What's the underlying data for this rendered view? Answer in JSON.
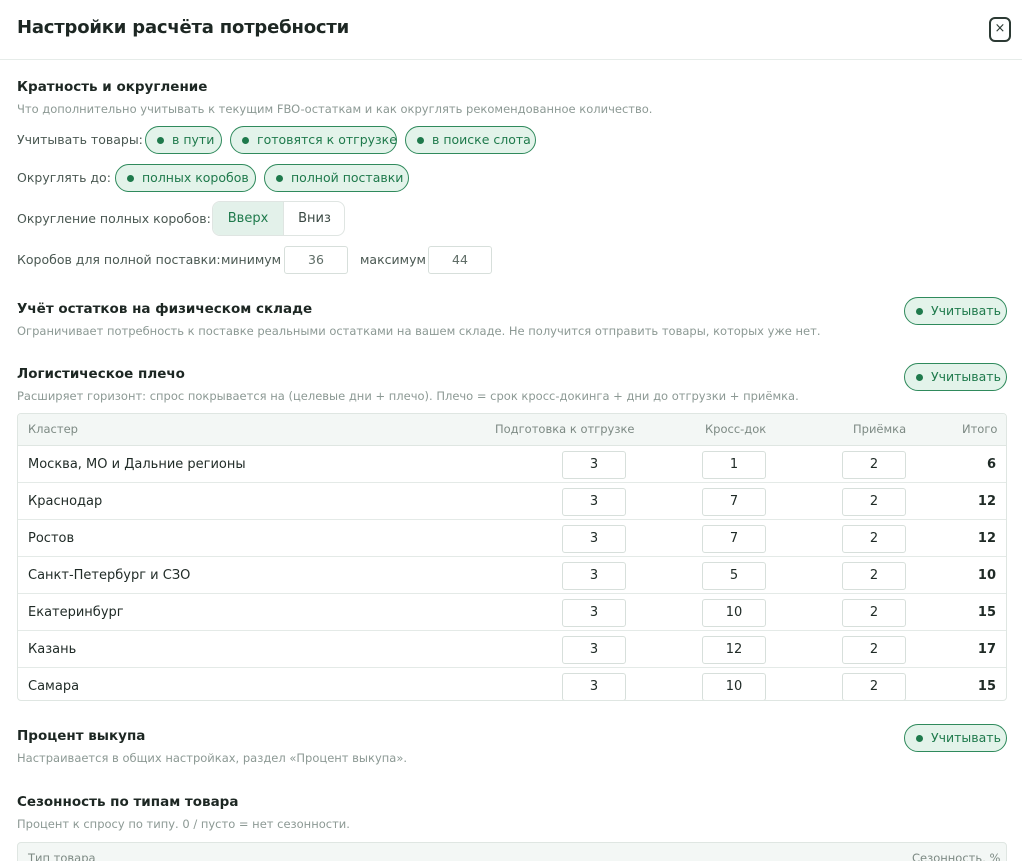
{
  "modal": {
    "title": "Настройки расчёта потребности",
    "close_label": "×"
  },
  "rounding": {
    "title": "Кратность и округление",
    "description": "Что дополнительно учитывать к текущим FBO-остаткам и как округлять рекомендованное количество.",
    "consider_label": "Учитывать товары:",
    "consider_chips": [
      "в пути",
      "готовятся к отгрузке",
      "в поиске слота"
    ],
    "round_to_label": "Округлять до:",
    "round_to_chips": [
      "полных коробов",
      "полной поставки"
    ],
    "box_rounding_label": "Округление полных коробов:",
    "box_rounding_options": [
      "Вверх",
      "Вниз"
    ],
    "box_rounding_selected": "Вверх",
    "boxes_label": "Коробов для полной поставки:",
    "min_label": "минимум",
    "min_value": "36",
    "max_label": "максимум",
    "max_value": "44"
  },
  "warehouse": {
    "title": "Учёт остатков на физическом складе",
    "description": "Ограничивает потребность к поставке реальными остатками на вашем складе. Не получится отправить товары, которых уже нет.",
    "toggle_label": "Учитывать"
  },
  "logistics": {
    "title": "Логистическое плечо",
    "description": "Расширяет горизонт: спрос покрывается на (целевые дни + плечо). Плечо = срок кросс-докинга + дни до отгрузки + приёмка.",
    "toggle_label": "Учитывать",
    "columns": [
      "Кластер",
      "Подготовка к отгрузке",
      "Кросс-док",
      "Приёмка",
      "Итого"
    ],
    "rows": [
      {
        "cluster": "Москва, МО и Дальние регионы",
        "prep": "3",
        "cross": "1",
        "accept": "2",
        "total": "6"
      },
      {
        "cluster": "Краснодар",
        "prep": "3",
        "cross": "7",
        "accept": "2",
        "total": "12"
      },
      {
        "cluster": "Ростов",
        "prep": "3",
        "cross": "7",
        "accept": "2",
        "total": "12"
      },
      {
        "cluster": "Санкт-Петербург и СЗО",
        "prep": "3",
        "cross": "5",
        "accept": "2",
        "total": "10"
      },
      {
        "cluster": "Екатеринбург",
        "prep": "3",
        "cross": "10",
        "accept": "2",
        "total": "15"
      },
      {
        "cluster": "Казань",
        "prep": "3",
        "cross": "12",
        "accept": "2",
        "total": "17"
      },
      {
        "cluster": "Самара",
        "prep": "3",
        "cross": "10",
        "accept": "2",
        "total": "15"
      }
    ]
  },
  "buyout": {
    "title": "Процент выкупа",
    "description": "Настраивается в общих настройках, раздел «Процент выкупа».",
    "toggle_label": "Учитывать"
  },
  "seasonality": {
    "title": "Сезонность по типам товара",
    "description": "Процент к спросу по типу. 0 / пусто = нет сезонности.",
    "columns": [
      "Тип товара",
      "Сезонность, %"
    ]
  },
  "colors": {
    "accent": "#1f7a4c",
    "accent_bg": "#e3f3ea",
    "text": "#1f2a26",
    "muted": "#8c9994"
  }
}
